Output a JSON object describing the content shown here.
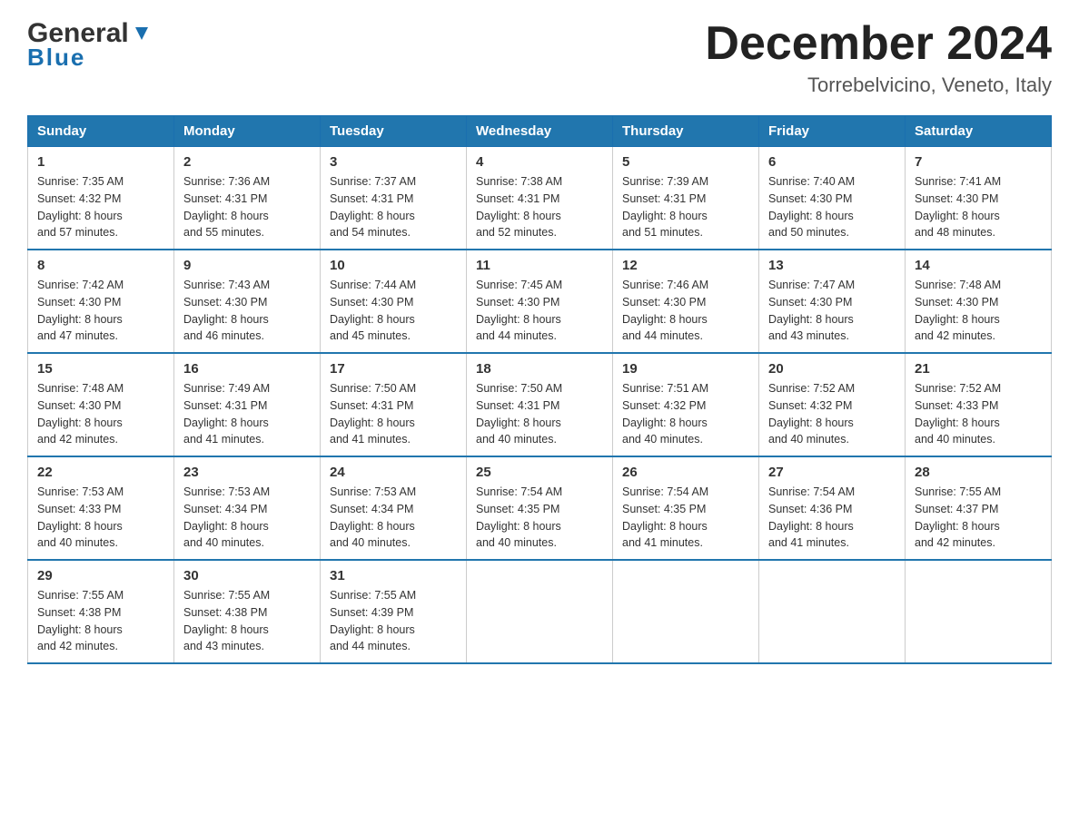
{
  "header": {
    "logo_general": "General",
    "logo_blue": "Blue",
    "month_title": "December 2024",
    "location": "Torrebelvicino, Veneto, Italy"
  },
  "days_of_week": [
    "Sunday",
    "Monday",
    "Tuesday",
    "Wednesday",
    "Thursday",
    "Friday",
    "Saturday"
  ],
  "weeks": [
    [
      {
        "day": "1",
        "sunrise": "7:35 AM",
        "sunset": "4:32 PM",
        "daylight": "8 hours and 57 minutes."
      },
      {
        "day": "2",
        "sunrise": "7:36 AM",
        "sunset": "4:31 PM",
        "daylight": "8 hours and 55 minutes."
      },
      {
        "day": "3",
        "sunrise": "7:37 AM",
        "sunset": "4:31 PM",
        "daylight": "8 hours and 54 minutes."
      },
      {
        "day": "4",
        "sunrise": "7:38 AM",
        "sunset": "4:31 PM",
        "daylight": "8 hours and 52 minutes."
      },
      {
        "day": "5",
        "sunrise": "7:39 AM",
        "sunset": "4:31 PM",
        "daylight": "8 hours and 51 minutes."
      },
      {
        "day": "6",
        "sunrise": "7:40 AM",
        "sunset": "4:30 PM",
        "daylight": "8 hours and 50 minutes."
      },
      {
        "day": "7",
        "sunrise": "7:41 AM",
        "sunset": "4:30 PM",
        "daylight": "8 hours and 48 minutes."
      }
    ],
    [
      {
        "day": "8",
        "sunrise": "7:42 AM",
        "sunset": "4:30 PM",
        "daylight": "8 hours and 47 minutes."
      },
      {
        "day": "9",
        "sunrise": "7:43 AM",
        "sunset": "4:30 PM",
        "daylight": "8 hours and 46 minutes."
      },
      {
        "day": "10",
        "sunrise": "7:44 AM",
        "sunset": "4:30 PM",
        "daylight": "8 hours and 45 minutes."
      },
      {
        "day": "11",
        "sunrise": "7:45 AM",
        "sunset": "4:30 PM",
        "daylight": "8 hours and 44 minutes."
      },
      {
        "day": "12",
        "sunrise": "7:46 AM",
        "sunset": "4:30 PM",
        "daylight": "8 hours and 44 minutes."
      },
      {
        "day": "13",
        "sunrise": "7:47 AM",
        "sunset": "4:30 PM",
        "daylight": "8 hours and 43 minutes."
      },
      {
        "day": "14",
        "sunrise": "7:48 AM",
        "sunset": "4:30 PM",
        "daylight": "8 hours and 42 minutes."
      }
    ],
    [
      {
        "day": "15",
        "sunrise": "7:48 AM",
        "sunset": "4:30 PM",
        "daylight": "8 hours and 42 minutes."
      },
      {
        "day": "16",
        "sunrise": "7:49 AM",
        "sunset": "4:31 PM",
        "daylight": "8 hours and 41 minutes."
      },
      {
        "day": "17",
        "sunrise": "7:50 AM",
        "sunset": "4:31 PM",
        "daylight": "8 hours and 41 minutes."
      },
      {
        "day": "18",
        "sunrise": "7:50 AM",
        "sunset": "4:31 PM",
        "daylight": "8 hours and 40 minutes."
      },
      {
        "day": "19",
        "sunrise": "7:51 AM",
        "sunset": "4:32 PM",
        "daylight": "8 hours and 40 minutes."
      },
      {
        "day": "20",
        "sunrise": "7:52 AM",
        "sunset": "4:32 PM",
        "daylight": "8 hours and 40 minutes."
      },
      {
        "day": "21",
        "sunrise": "7:52 AM",
        "sunset": "4:33 PM",
        "daylight": "8 hours and 40 minutes."
      }
    ],
    [
      {
        "day": "22",
        "sunrise": "7:53 AM",
        "sunset": "4:33 PM",
        "daylight": "8 hours and 40 minutes."
      },
      {
        "day": "23",
        "sunrise": "7:53 AM",
        "sunset": "4:34 PM",
        "daylight": "8 hours and 40 minutes."
      },
      {
        "day": "24",
        "sunrise": "7:53 AM",
        "sunset": "4:34 PM",
        "daylight": "8 hours and 40 minutes."
      },
      {
        "day": "25",
        "sunrise": "7:54 AM",
        "sunset": "4:35 PM",
        "daylight": "8 hours and 40 minutes."
      },
      {
        "day": "26",
        "sunrise": "7:54 AM",
        "sunset": "4:35 PM",
        "daylight": "8 hours and 41 minutes."
      },
      {
        "day": "27",
        "sunrise": "7:54 AM",
        "sunset": "4:36 PM",
        "daylight": "8 hours and 41 minutes."
      },
      {
        "day": "28",
        "sunrise": "7:55 AM",
        "sunset": "4:37 PM",
        "daylight": "8 hours and 42 minutes."
      }
    ],
    [
      {
        "day": "29",
        "sunrise": "7:55 AM",
        "sunset": "4:38 PM",
        "daylight": "8 hours and 42 minutes."
      },
      {
        "day": "30",
        "sunrise": "7:55 AM",
        "sunset": "4:38 PM",
        "daylight": "8 hours and 43 minutes."
      },
      {
        "day": "31",
        "sunrise": "7:55 AM",
        "sunset": "4:39 PM",
        "daylight": "8 hours and 44 minutes."
      },
      null,
      null,
      null,
      null
    ]
  ],
  "labels": {
    "sunrise": "Sunrise:",
    "sunset": "Sunset:",
    "daylight": "Daylight:"
  }
}
